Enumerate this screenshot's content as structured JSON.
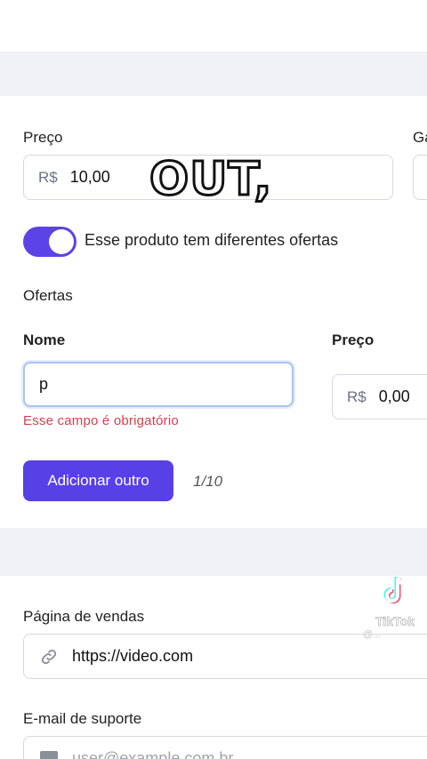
{
  "price": {
    "label": "Preço",
    "currency": "R$",
    "value": "10,00"
  },
  "cut_label": "Ga",
  "toggle": {
    "label": "Esse produto tem diferentes ofertas",
    "on": true
  },
  "offers": {
    "section_label": "Ofertas",
    "name_label": "Nome",
    "name_value": "p",
    "price_label": "Preço",
    "price_currency": "R$",
    "price_value": "0,00",
    "error": "Esse campo é obrigatório",
    "add_button": "Adicionar outro",
    "counter": "1/10"
  },
  "sales_page": {
    "label": "Página de vendas",
    "value": "https://video.com"
  },
  "support_email": {
    "label": "E-mail de suporte",
    "placeholder": "user@example.com.br"
  },
  "overlay": {
    "caption": "OUT,",
    "brand": "TikTok",
    "handle": "@..."
  },
  "colors": {
    "accent": "#5740e6",
    "error": "#d43f4f",
    "band": "#f1f2f5"
  }
}
